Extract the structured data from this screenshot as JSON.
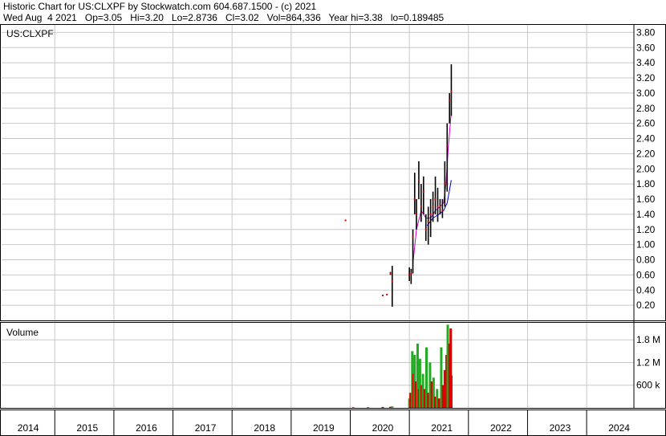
{
  "header": {
    "line1": "Historic Chart for US:CLXPF by Stockwatch.com 604.687.1500 - (c) 2021",
    "line2": "Wed Aug  4 2021   Op=3.05   Hi=3.20   Lo=2.8736   Cl=3.02   Vol=864,336   Year hi=3.38   lo=0.189485"
  },
  "chart_data": [
    {
      "type": "line",
      "title": "US:CLXPF",
      "y_tick_labels": [
        "3.80",
        "3.60",
        "3.40",
        "3.20",
        "3.00",
        "2.80",
        "2.60",
        "2.40",
        "2.20",
        "2.00",
        "1.80",
        "1.60",
        "1.40",
        "1.20",
        "1.00",
        "0.80",
        "0.60",
        "0.40",
        "0.20"
      ],
      "ylim": [
        0,
        3.9
      ],
      "x_tick_labels": [
        "2014",
        "2015",
        "2016",
        "2017",
        "2018",
        "2019",
        "2020",
        "2021",
        "2022",
        "2023",
        "2024"
      ],
      "xlim": [
        2013.6,
        2024.3
      ],
      "grid": true,
      "colors": {
        "price": "#000000",
        "close_dot": "#cc0000",
        "ma_short": "#cc00cc",
        "ma_long": "#0000cc"
      },
      "price_series": [
        {
          "t": 2019.42,
          "lo": 1.32,
          "hi": 1.32,
          "c": 1.32
        },
        {
          "t": 2020.05,
          "lo": 0.33,
          "hi": 0.33,
          "c": 0.33
        },
        {
          "t": 2020.12,
          "lo": 0.34,
          "hi": 0.34,
          "c": 0.34
        },
        {
          "t": 2020.18,
          "lo": 0.6,
          "hi": 0.64,
          "c": 0.62
        },
        {
          "t": 2020.21,
          "lo": 0.18,
          "hi": 0.72,
          "c": 0.52
        },
        {
          "t": 2020.5,
          "lo": 0.52,
          "hi": 0.7,
          "c": 0.6
        },
        {
          "t": 2020.53,
          "lo": 0.48,
          "hi": 0.68,
          "c": 0.62
        },
        {
          "t": 2020.56,
          "lo": 0.62,
          "hi": 1.2,
          "c": 1.1
        },
        {
          "t": 2020.59,
          "lo": 1.4,
          "hi": 1.95,
          "c": 1.6
        },
        {
          "t": 2020.62,
          "lo": 1.2,
          "hi": 1.6,
          "c": 1.4
        },
        {
          "t": 2020.66,
          "lo": 1.6,
          "hi": 2.1,
          "c": 1.85
        },
        {
          "t": 2020.7,
          "lo": 1.3,
          "hi": 1.8,
          "c": 1.5
        },
        {
          "t": 2020.74,
          "lo": 1.4,
          "hi": 1.9,
          "c": 1.7
        },
        {
          "t": 2020.78,
          "lo": 1.05,
          "hi": 1.4,
          "c": 1.2
        },
        {
          "t": 2020.82,
          "lo": 1.0,
          "hi": 1.5,
          "c": 1.3
        },
        {
          "t": 2020.86,
          "lo": 1.1,
          "hi": 1.6,
          "c": 1.4
        },
        {
          "t": 2020.9,
          "lo": 1.3,
          "hi": 1.7,
          "c": 1.5
        },
        {
          "t": 2020.94,
          "lo": 1.4,
          "hi": 1.9,
          "c": 1.6
        },
        {
          "t": 2020.98,
          "lo": 1.3,
          "hi": 1.75,
          "c": 1.5
        },
        {
          "t": 2021.02,
          "lo": 1.4,
          "hi": 1.6,
          "c": 1.5
        },
        {
          "t": 2021.06,
          "lo": 1.35,
          "hi": 1.6,
          "c": 1.45
        },
        {
          "t": 2021.1,
          "lo": 1.5,
          "hi": 2.1,
          "c": 1.8
        },
        {
          "t": 2021.14,
          "lo": 1.7,
          "hi": 2.6,
          "c": 2.3
        },
        {
          "t": 2021.18,
          "lo": 2.6,
          "hi": 3.0,
          "c": 2.9
        },
        {
          "t": 2021.21,
          "lo": 2.7,
          "hi": 3.38,
          "c": 3.02
        }
      ],
      "ma_short": [
        {
          "t": 2020.56,
          "v": 0.75
        },
        {
          "t": 2020.62,
          "v": 1.2
        },
        {
          "t": 2020.7,
          "v": 1.45
        },
        {
          "t": 2020.78,
          "v": 1.35
        },
        {
          "t": 2020.86,
          "v": 1.35
        },
        {
          "t": 2020.94,
          "v": 1.45
        },
        {
          "t": 2021.02,
          "v": 1.5
        },
        {
          "t": 2021.08,
          "v": 1.55
        },
        {
          "t": 2021.12,
          "v": 1.8
        },
        {
          "t": 2021.16,
          "v": 2.3
        },
        {
          "t": 2021.21,
          "v": 2.75
        }
      ],
      "ma_long": [
        {
          "t": 2020.8,
          "v": 1.25
        },
        {
          "t": 2020.9,
          "v": 1.35
        },
        {
          "t": 2021.0,
          "v": 1.4
        },
        {
          "t": 2021.08,
          "v": 1.45
        },
        {
          "t": 2021.14,
          "v": 1.55
        },
        {
          "t": 2021.21,
          "v": 1.85
        }
      ]
    },
    {
      "type": "bar",
      "title": "Volume",
      "y_tick_labels": [
        "1.8 M",
        "1.2 M",
        "600 k"
      ],
      "y_tick_values": [
        1800000,
        1200000,
        600000
      ],
      "ylim": [
        0,
        2250000
      ],
      "colors": {
        "up": "#22aa22",
        "down": "#dd0000"
      },
      "bars": [
        {
          "t": 2019.55,
          "v": 15000,
          "dir": "down"
        },
        {
          "t": 2019.8,
          "v": 20000,
          "dir": "up"
        },
        {
          "t": 2020.05,
          "v": 25000,
          "dir": "down"
        },
        {
          "t": 2020.18,
          "v": 30000,
          "dir": "down"
        },
        {
          "t": 2020.21,
          "v": 40000,
          "dir": "up"
        },
        {
          "t": 2020.5,
          "v": 250000,
          "dir": "up"
        },
        {
          "t": 2020.52,
          "v": 400000,
          "dir": "down"
        },
        {
          "t": 2020.55,
          "v": 1500000,
          "dir": "up"
        },
        {
          "t": 2020.57,
          "v": 900000,
          "dir": "down"
        },
        {
          "t": 2020.59,
          "v": 1400000,
          "dir": "up"
        },
        {
          "t": 2020.61,
          "v": 700000,
          "dir": "down"
        },
        {
          "t": 2020.64,
          "v": 1700000,
          "dir": "up"
        },
        {
          "t": 2020.66,
          "v": 500000,
          "dir": "down"
        },
        {
          "t": 2020.68,
          "v": 1300000,
          "dir": "up"
        },
        {
          "t": 2020.71,
          "v": 600000,
          "dir": "down"
        },
        {
          "t": 2020.73,
          "v": 900000,
          "dir": "up"
        },
        {
          "t": 2020.76,
          "v": 500000,
          "dir": "down"
        },
        {
          "t": 2020.79,
          "v": 1600000,
          "dir": "up"
        },
        {
          "t": 2020.82,
          "v": 400000,
          "dir": "down"
        },
        {
          "t": 2020.85,
          "v": 1200000,
          "dir": "up"
        },
        {
          "t": 2020.88,
          "v": 700000,
          "dir": "down"
        },
        {
          "t": 2020.91,
          "v": 800000,
          "dir": "up"
        },
        {
          "t": 2020.94,
          "v": 300000,
          "dir": "down"
        },
        {
          "t": 2020.97,
          "v": 500000,
          "dir": "up"
        },
        {
          "t": 2021.0,
          "v": 250000,
          "dir": "down"
        },
        {
          "t": 2021.04,
          "v": 1600000,
          "dir": "up"
        },
        {
          "t": 2021.07,
          "v": 600000,
          "dir": "down"
        },
        {
          "t": 2021.1,
          "v": 1000000,
          "dir": "down"
        },
        {
          "t": 2021.13,
          "v": 1400000,
          "dir": "down"
        },
        {
          "t": 2021.15,
          "v": 2200000,
          "dir": "up"
        },
        {
          "t": 2021.18,
          "v": 1700000,
          "dir": "down"
        },
        {
          "t": 2021.2,
          "v": 2100000,
          "dir": "down"
        },
        {
          "t": 2021.21,
          "v": 860000,
          "dir": "down"
        }
      ]
    }
  ]
}
